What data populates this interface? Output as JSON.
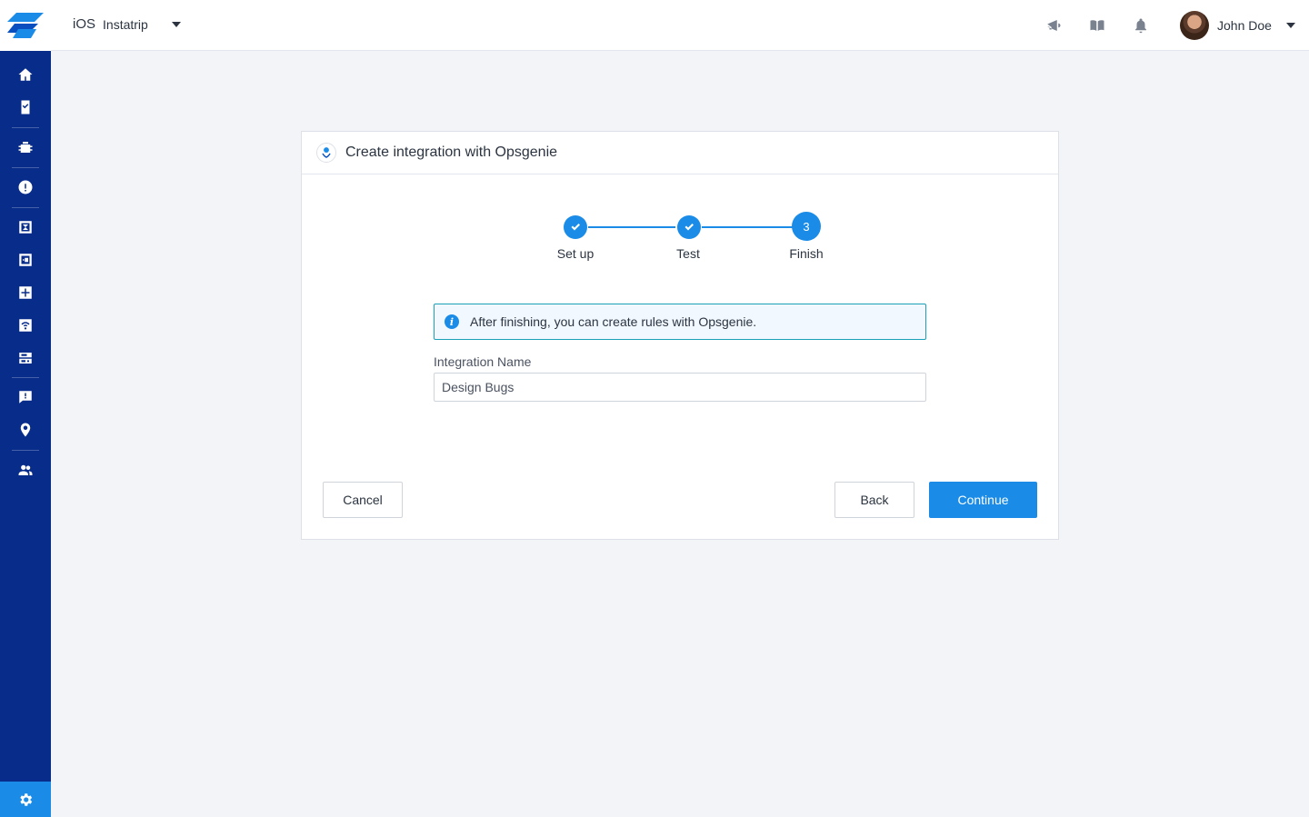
{
  "sidebar": {
    "items": [
      {
        "icon": "home-icon"
      },
      {
        "icon": "clipboard-icon"
      },
      {
        "icon": "bug-icon"
      },
      {
        "icon": "alert-icon"
      },
      {
        "icon": "crash-icon"
      },
      {
        "icon": "survey-icon"
      },
      {
        "icon": "apm-icon"
      },
      {
        "icon": "network-icon"
      },
      {
        "icon": "sessions-icon"
      },
      {
        "icon": "feedback-icon"
      },
      {
        "icon": "location-icon"
      },
      {
        "icon": "team-icon"
      }
    ],
    "settings_icon": "gear-icon"
  },
  "topbar": {
    "platform": "iOS",
    "app_name": "Instatrip",
    "icons": [
      "megaphone-icon",
      "book-icon",
      "bell-icon"
    ],
    "user_name": "John Doe"
  },
  "dialog": {
    "title": "Create integration with Opsgenie",
    "steps": [
      {
        "label": "Set up",
        "state": "done"
      },
      {
        "label": "Test",
        "state": "done"
      },
      {
        "label": "Finish",
        "state": "active",
        "number": "3"
      }
    ],
    "info_text": "After finishing, you can create rules with Opsgenie.",
    "field_label": "Integration Name",
    "field_value": "Design Bugs",
    "cancel_label": "Cancel",
    "back_label": "Back",
    "continue_label": "Continue"
  },
  "colors": {
    "sidebar": "#082c8a",
    "accent": "#1a8ce8",
    "background": "#f2f4f8"
  }
}
